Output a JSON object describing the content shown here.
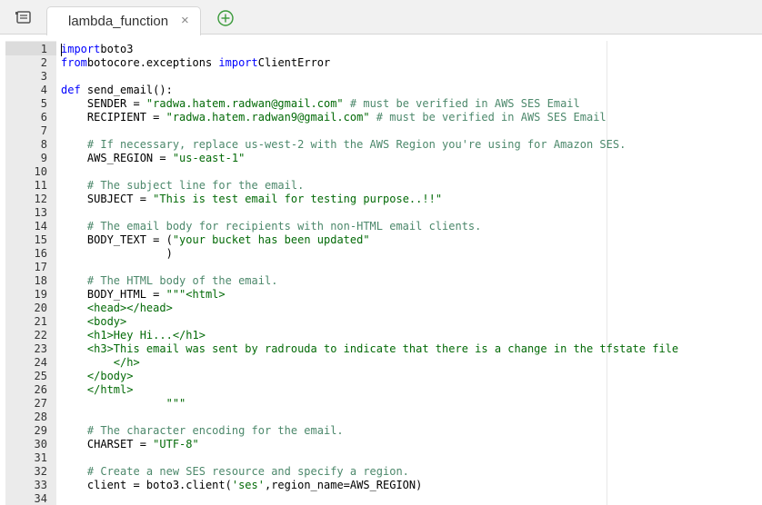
{
  "toolbar": {
    "menu_icon": "list-icon",
    "add_icon": "plus-circle-icon"
  },
  "tab": {
    "label": "lambda_function",
    "close_label": "×"
  },
  "colors": {
    "keyword": "#0000ff",
    "string": "#036a07",
    "comment": "#4c886b"
  },
  "code_lines": [
    [
      [
        "kw",
        "import"
      ],
      [
        "",
        "boto3"
      ]
    ],
    [
      [
        "kw",
        "from"
      ],
      [
        "",
        "botocore.exceptions "
      ],
      [
        "kw",
        "import"
      ],
      [
        "",
        "ClientError"
      ]
    ],
    [],
    [
      [
        "kw",
        "def"
      ],
      [
        "",
        " send_email():"
      ]
    ],
    [
      [
        "",
        "    SENDER = "
      ],
      [
        "str",
        "\"radwa.hatem.radwan@gmail.com\""
      ],
      [
        "com",
        " # must be verified in AWS SES Email"
      ]
    ],
    [
      [
        "",
        "    RECIPIENT = "
      ],
      [
        "str",
        "\"radwa.hatem.radwan9@gmail.com\""
      ],
      [
        "com",
        " # must be verified in AWS SES Email"
      ]
    ],
    [],
    [
      [
        "com",
        "    # If necessary, replace us-west-2 with the AWS Region you're using for Amazon SES."
      ]
    ],
    [
      [
        "",
        "    AWS_REGION = "
      ],
      [
        "str",
        "\"us-east-1\""
      ]
    ],
    [],
    [
      [
        "com",
        "    # The subject line for the email."
      ]
    ],
    [
      [
        "",
        "    SUBJECT = "
      ],
      [
        "str",
        "\"This is test email for testing purpose..!!\""
      ]
    ],
    [],
    [
      [
        "com",
        "    # The email body for recipients with non-HTML email clients."
      ]
    ],
    [
      [
        "",
        "    BODY_TEXT = ("
      ],
      [
        "str",
        "\"your bucket has been updated\""
      ]
    ],
    [
      [
        "",
        "                )"
      ]
    ],
    [],
    [
      [
        "com",
        "    # The HTML body of the email."
      ]
    ],
    [
      [
        "",
        "    BODY_HTML = "
      ],
      [
        "str",
        "\"\"\"<html>"
      ]
    ],
    [
      [
        "str",
        "    <head></head>"
      ]
    ],
    [
      [
        "str",
        "    <body>"
      ]
    ],
    [
      [
        "str",
        "    <h1>Hey Hi...</h1>"
      ]
    ],
    [
      [
        "str",
        "    <h3>This email was sent by radrouda to indicate that there is a change in the tfstate file"
      ]
    ],
    [
      [
        "str",
        "        </h>"
      ]
    ],
    [
      [
        "str",
        "    </body>"
      ]
    ],
    [
      [
        "str",
        "    </html>"
      ]
    ],
    [
      [
        "str",
        "                \"\"\""
      ]
    ],
    [],
    [
      [
        "com",
        "    # The character encoding for the email."
      ]
    ],
    [
      [
        "",
        "    CHARSET = "
      ],
      [
        "str",
        "\"UTF-8\""
      ]
    ],
    [],
    [
      [
        "com",
        "    # Create a new SES resource and specify a region."
      ]
    ],
    [
      [
        "",
        "    client = boto3.client("
      ],
      [
        "str",
        "'ses'"
      ],
      [
        "",
        ",region_name=AWS_REGION)"
      ]
    ],
    []
  ]
}
